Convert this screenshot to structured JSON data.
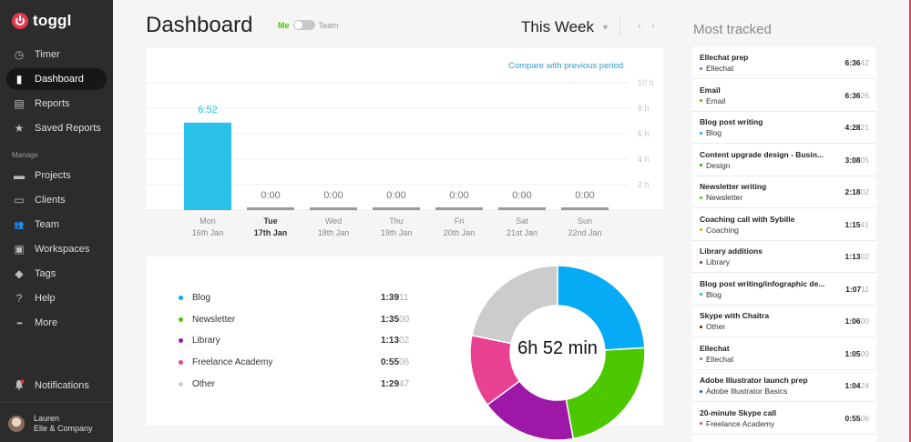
{
  "app": {
    "name": "toggl"
  },
  "sidebar": {
    "items": [
      {
        "label": "Timer",
        "icon": "clock-icon",
        "glyph": "◷"
      },
      {
        "label": "Dashboard",
        "icon": "bar-chart-icon",
        "glyph": "▮"
      },
      {
        "label": "Reports",
        "icon": "report-icon",
        "glyph": "▤"
      },
      {
        "label": "Saved Reports",
        "icon": "star-icon",
        "glyph": "★"
      }
    ],
    "manage_label": "Manage",
    "manage_items": [
      {
        "label": "Projects",
        "icon": "folder-icon",
        "glyph": "▬"
      },
      {
        "label": "Clients",
        "icon": "briefcase-icon",
        "glyph": "▭"
      },
      {
        "label": "Team",
        "icon": "team-icon",
        "glyph": "👥"
      },
      {
        "label": "Workspaces",
        "icon": "workspace-icon",
        "glyph": "▣"
      },
      {
        "label": "Tags",
        "icon": "tag-icon",
        "glyph": "◆"
      },
      {
        "label": "Help",
        "icon": "help-icon",
        "glyph": "?"
      },
      {
        "label": "More",
        "icon": "more-icon",
        "glyph": "•••"
      }
    ],
    "notifications_label": "Notifications",
    "user": {
      "name": "Lauren",
      "company": "Elle & Company"
    }
  },
  "header": {
    "title": "Dashboard",
    "toggle_me": "Me",
    "toggle_team": "Team",
    "range": "This Week"
  },
  "bar_card": {
    "compare_link": "Compare with previous period"
  },
  "chart_data": {
    "type": "bar",
    "categories": [
      "Mon",
      "Tue",
      "Wed",
      "Thu",
      "Fri",
      "Sat",
      "Sun"
    ],
    "dates": [
      "16th Jan",
      "17th Jan",
      "18th Jan",
      "19th Jan",
      "20th Jan",
      "21st Jan",
      "22nd Jan"
    ],
    "values_hours": [
      6.867,
      0,
      0,
      0,
      0,
      0,
      0
    ],
    "value_labels": [
      "6:52",
      "0:00",
      "0:00",
      "0:00",
      "0:00",
      "0:00",
      "0:00"
    ],
    "highlight_day": "Tue",
    "y_ticks": [
      {
        "v": 10,
        "label": "10 h"
      },
      {
        "v": 8,
        "label": "8 h"
      },
      {
        "v": 6,
        "label": "6 h"
      },
      {
        "v": 4,
        "label": "4 h"
      },
      {
        "v": 2,
        "label": "2 h"
      }
    ],
    "ylim": [
      0,
      10
    ],
    "bar_color": "#29c1e8",
    "empty_color": "#9a9a9a"
  },
  "summary": {
    "total_label": "6h 52 min",
    "projects": [
      {
        "name": "Blog",
        "time_main": "1:39",
        "time_sec": "11",
        "color": "#06aaf5",
        "seconds": 5951
      },
      {
        "name": "Newsletter",
        "time_main": "1:35",
        "time_sec": "00",
        "color": "#4bc800",
        "seconds": 5700
      },
      {
        "name": "Library",
        "time_main": "1:13",
        "time_sec": "02",
        "color": "#9e18a8",
        "seconds": 4382
      },
      {
        "name": "Freelance Academy",
        "time_main": "0:55",
        "time_sec": "06",
        "color": "#e84192",
        "seconds": 3306
      },
      {
        "name": "Other",
        "time_main": "1:29",
        "time_sec": "47",
        "color": "#cccccc",
        "seconds": 5387
      }
    ]
  },
  "most_tracked": {
    "title": "Most tracked",
    "entries": [
      {
        "name": "Ellechat prep",
        "project": "Ellechat",
        "color": "#9e5bd9",
        "time_main": "6:36",
        "time_sec": "42"
      },
      {
        "name": "Email",
        "project": "Email",
        "color": "#4bc800",
        "time_main": "6:36",
        "time_sec": "26"
      },
      {
        "name": "Blog post writing",
        "project": "Blog",
        "color": "#06aaf5",
        "time_main": "4:28",
        "time_sec": "21"
      },
      {
        "name": "Content upgrade design - Busin...",
        "project": "Design",
        "color": "#2da608",
        "time_main": "3:08",
        "time_sec": "05"
      },
      {
        "name": "Newsletter writing",
        "project": "Newsletter",
        "color": "#4bc800",
        "time_main": "2:18",
        "time_sec": "02"
      },
      {
        "name": "Coaching call with Sybille",
        "project": "Coaching",
        "color": "#e8a200",
        "time_main": "1:15",
        "time_sec": "41"
      },
      {
        "name": "Library additions",
        "project": "Library",
        "color": "#9e18a8",
        "time_main": "1:13",
        "time_sec": "02"
      },
      {
        "name": "Blog post writing/infographic de...",
        "project": "Blog",
        "color": "#06aaf5",
        "time_main": "1:07",
        "time_sec": "11"
      },
      {
        "name": "Skype with Chaitra",
        "project": "Other",
        "color": "#8b0000",
        "time_main": "1:06",
        "time_sec": "00"
      },
      {
        "name": "Ellechat",
        "project": "Ellechat",
        "color": "#9e5bd9",
        "time_main": "1:05",
        "time_sec": "00"
      },
      {
        "name": "Adobe Illustrator launch prep",
        "project": "Adobe Illustrator Basics",
        "color": "#2f4fa8",
        "time_main": "1:04",
        "time_sec": "24"
      },
      {
        "name": "20-minute Skype call",
        "project": "Freelance Academy",
        "color": "#e84192",
        "time_main": "0:55",
        "time_sec": "06"
      }
    ]
  }
}
